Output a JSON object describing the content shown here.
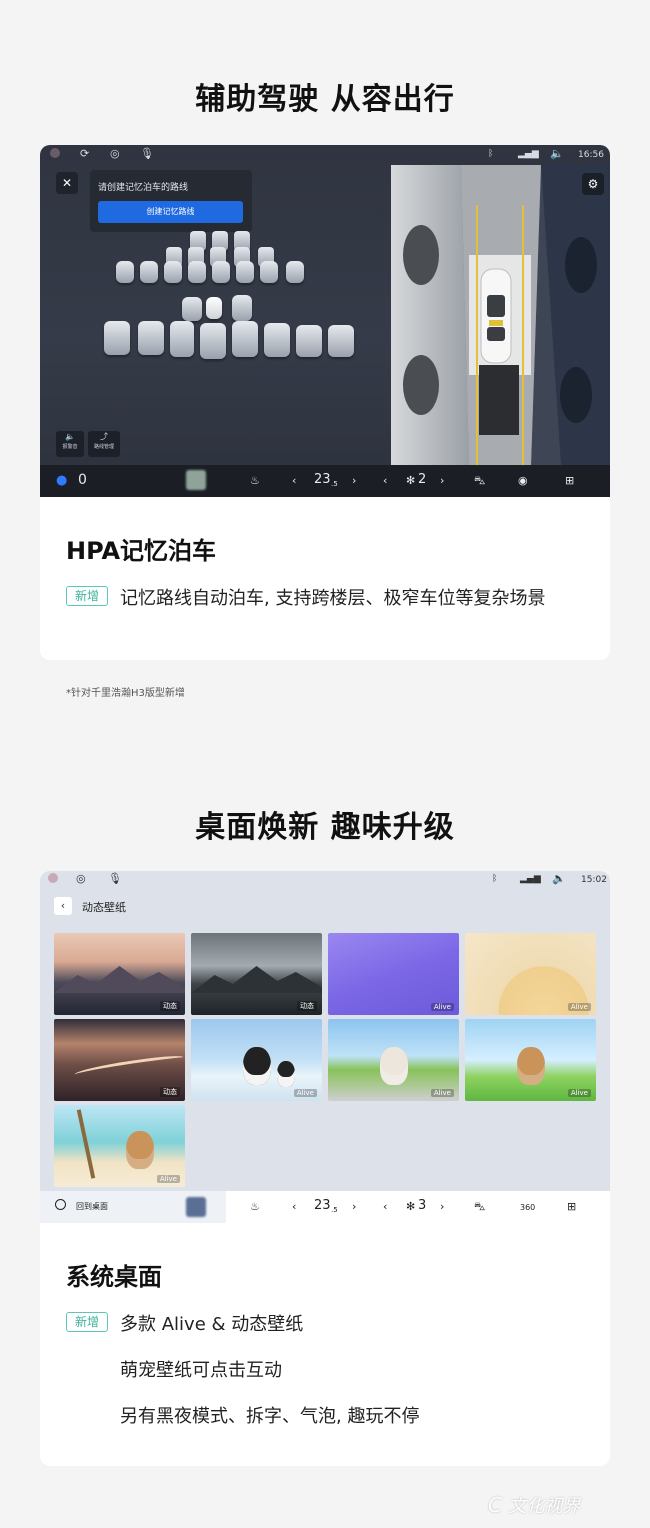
{
  "section1": {
    "title": "辅助驾驶 从容出行",
    "screen": {
      "status_time": "16:56",
      "prompt_text": "请创建记忆泊车的路线",
      "create_button": "创建记忆路线",
      "close_glyph": "✕",
      "side_btn_1": "报警音",
      "side_btn_2": "路线管理",
      "bottom": {
        "speed": "0",
        "temp_main": "23",
        "temp_sub": ".5",
        "fan_level": "2"
      }
    },
    "card": {
      "title": "HPA记忆泊车",
      "tag": "新增",
      "desc": "记忆路线自动泊车, 支持跨楼层、极窄车位等复杂场景"
    },
    "footnote": "*针对千里浩瀚H3版型新增"
  },
  "section2": {
    "title": "桌面焕新 趣味升级",
    "screen": {
      "status_time": "15:02",
      "header_title": "动态壁纸",
      "wallpapers": [
        {
          "label": "动态"
        },
        {
          "label": "动态"
        },
        {
          "label": "Alive"
        },
        {
          "label": "Alive"
        },
        {
          "label": "动态"
        },
        {
          "label": "Alive"
        },
        {
          "label": "Alive"
        },
        {
          "label": "Alive"
        },
        {
          "label": "Alive"
        }
      ],
      "bottom": {
        "home_label": "回到桌面",
        "temp_main": "23",
        "temp_sub": ".5",
        "fan_level": "3",
        "view_360": "360"
      }
    },
    "card": {
      "title": "系统桌面",
      "tag": "新增",
      "desc_lines": [
        "多款 Alive & 动态壁纸",
        "萌宠壁纸可点击互动",
        "另有黑夜模式、拆字、气泡, 趣玩不停"
      ]
    }
  },
  "watermark": "文化视界",
  "colors": {
    "accent_blue": "#1f6ae0",
    "tag_green": "#3db19c"
  }
}
